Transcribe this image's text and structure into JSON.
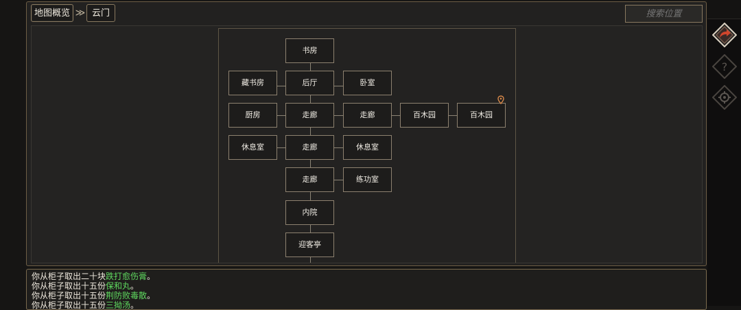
{
  "breadcrumb": {
    "root": "地图概览",
    "separator": "≫",
    "current": "云门"
  },
  "search": {
    "placeholder": "搜索位置"
  },
  "map": {
    "rooms": {
      "study": "书房",
      "library": "藏书房",
      "back_hall": "后厅",
      "bedroom": "卧室",
      "kitchen": "厨房",
      "corridor_1": "走廊",
      "corridor_1_east": "走廊",
      "garden_1": "百木园",
      "garden_2": "百木园",
      "rest_room_west": "休息室",
      "corridor_2": "走廊",
      "rest_room_east": "休息室",
      "corridor_3": "走廊",
      "training_room": "练功室",
      "inner_court": "内院",
      "guest_pavilion": "迎客亭"
    },
    "current_location_icon": "location-pin-icon"
  },
  "side_buttons": [
    {
      "icon": "share-arrow-icon",
      "active": true
    },
    {
      "icon": "question-icon",
      "active": false
    },
    {
      "icon": "gear-icon",
      "active": false
    }
  ],
  "log": [
    {
      "prefix": "你从柜子取出二十块",
      "item": "跌打愈伤膏",
      "suffix": "。"
    },
    {
      "prefix": "你从柜子取出十五份",
      "item": "保和丸",
      "suffix": "。"
    },
    {
      "prefix": "你从柜子取出十五份",
      "item": "荆防败毒散",
      "suffix": "。"
    },
    {
      "prefix": "你从柜子取出十五份",
      "item": "三拗汤",
      "suffix": "。"
    }
  ],
  "colors": {
    "panel_border": "#6e5e46",
    "room_border": "#8e8270",
    "log_item_green": "#5fd85f",
    "active_button_red": "#d0452c"
  }
}
